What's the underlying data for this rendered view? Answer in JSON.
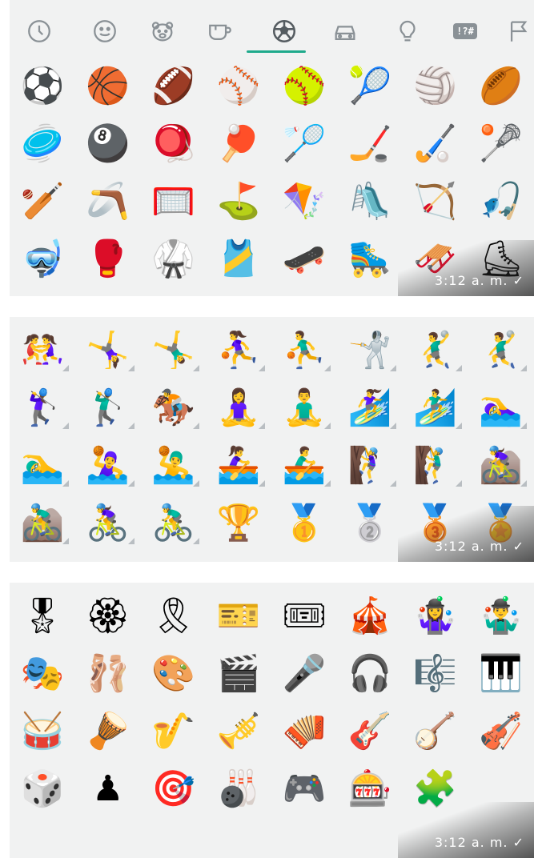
{
  "tabs": [
    {
      "name": "recent",
      "icon": "clock-icon"
    },
    {
      "name": "smileys",
      "icon": "smiley-icon"
    },
    {
      "name": "animals",
      "icon": "bear-icon"
    },
    {
      "name": "food",
      "icon": "coffee-cup-icon"
    },
    {
      "name": "activity",
      "icon": "soccer-ball-icon",
      "selected": true
    },
    {
      "name": "travel",
      "icon": "car-icon"
    },
    {
      "name": "objects",
      "icon": "lightbulb-icon"
    },
    {
      "name": "symbols",
      "icon": "symbols-icon",
      "label": "!?#"
    },
    {
      "name": "flags",
      "icon": "flag-icon"
    }
  ],
  "accent_color": "#1faa8c",
  "panels": [
    {
      "timestamp": "3:12 a. m. ✓",
      "emojis": [
        "⚽",
        "🏀",
        "🏈",
        "⚾",
        "🥎",
        "🎾",
        "🏐",
        "🏉",
        "🥏",
        "🎱",
        "🪀",
        "🏓",
        "🏸",
        "🏒",
        "🏑",
        "🥍",
        "🏏",
        "🪃",
        "🥅",
        "⛳",
        "🪁",
        "🛝",
        "🏹",
        "🎣",
        "🤿",
        "🥊",
        "🥋",
        "🎽",
        "🛹",
        "🛼",
        "🛷",
        "⛸"
      ]
    },
    {
      "timestamp": "3:12 a. m. ✓",
      "emojis": [
        "🤼‍♀️",
        "🤸‍♀️",
        "🤸‍♂️",
        "⛹️‍♀️",
        "⛹️‍♂️",
        "🤺",
        "🤾‍♂️",
        "🤾‍♂️",
        "🏌️‍♀️",
        "🏌️‍♂️",
        "🏇",
        "🧘‍♀️",
        "🧘‍♂️",
        "🏄‍♀️",
        "🏄‍♂️",
        "🏊‍♀️",
        "🏊‍♂️",
        "🤽‍♀️",
        "🤽‍♂️",
        "🚣‍♀️",
        "🚣‍♂️",
        "🧗‍♀️",
        "🧗‍♂️",
        "🚵‍♀️",
        "🚵‍♂️",
        "🚴‍♀️",
        "🚴‍♂️",
        "🏆",
        "🥇",
        "🥈",
        "🥉",
        "🏅"
      ]
    },
    {
      "timestamp": "3:12 a. m. ✓",
      "emojis": [
        "🎖",
        "🏵",
        "🎗",
        "🎫",
        "🎟",
        "🎪",
        "🤹‍♀️",
        "🤹‍♂️",
        "🎭",
        "🩰",
        "🎨",
        "🎬",
        "🎤",
        "🎧",
        "🎼",
        "🎹",
        "🥁",
        "🪘",
        "🎷",
        "🎺",
        "🪗",
        "🎸",
        "🪕",
        "🎻",
        "🎲",
        "♟",
        "🎯",
        "🎳",
        "🎮",
        "🎰",
        "🧩"
      ]
    }
  ]
}
